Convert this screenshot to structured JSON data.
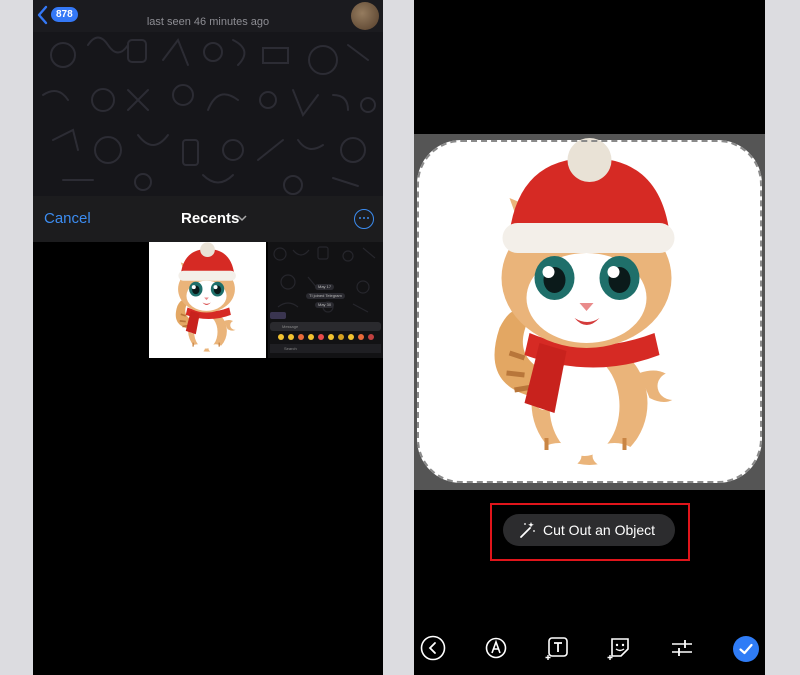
{
  "chat": {
    "back_count": "878",
    "contact_name": "",
    "status": "last seen 46 minutes ago"
  },
  "picker": {
    "cancel_label": "Cancel",
    "title": "Recents",
    "screenshot_thumb": {
      "date_badge": "May 17",
      "joined_text": "TI joined Telegram",
      "date_badge_2": "May 30",
      "input_placeholder": "Message",
      "search_placeholder": "Search"
    }
  },
  "editor": {
    "cutout_label": "Cut Out an Object",
    "toolbar": [
      "back-icon",
      "draw-icon",
      "text-icon",
      "sticker-icon",
      "adjust-icon",
      "done-icon"
    ],
    "colors": {
      "accent": "#2f7cf6",
      "highlight": "#e0151b"
    }
  }
}
